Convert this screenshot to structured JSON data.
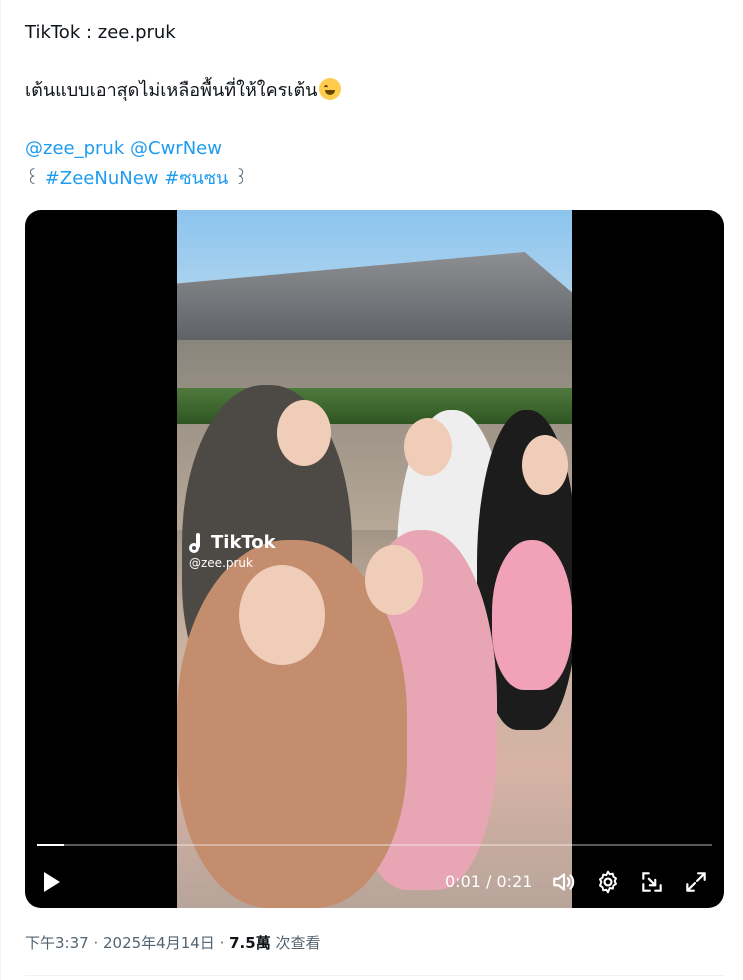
{
  "tweet": {
    "line1": "TikTok : zee.pruk",
    "line2": "เต้นแบบเอาสุดไม่เหลือพื้นที่ให้ใครเต้น",
    "emoji_icon": "rolling-on-floor-laughing-emoji",
    "mention1": "@zee_pruk",
    "mention2": "@CwrNew",
    "paren_open": "꒰",
    "hashtag1": "#ZeeNuNew",
    "hashtag2": "#ซนซน",
    "paren_close": "꒱"
  },
  "video": {
    "watermark_brand": "TikTok",
    "watermark_handle": "@zee.pruk",
    "time_display": "0:01 / 0:21",
    "progress_fraction": 0.04,
    "controls": {
      "play_icon": "play-icon",
      "volume_icon": "volume-icon",
      "settings_icon": "gear-icon",
      "pip_icon": "picture-in-picture-icon",
      "fullscreen_icon": "fullscreen-icon"
    }
  },
  "meta": {
    "time": "下午3:37",
    "sep1": " · ",
    "date": "2025年4月14日",
    "sep2": " · ",
    "views": "7.5萬",
    "views_label": " 次查看"
  }
}
